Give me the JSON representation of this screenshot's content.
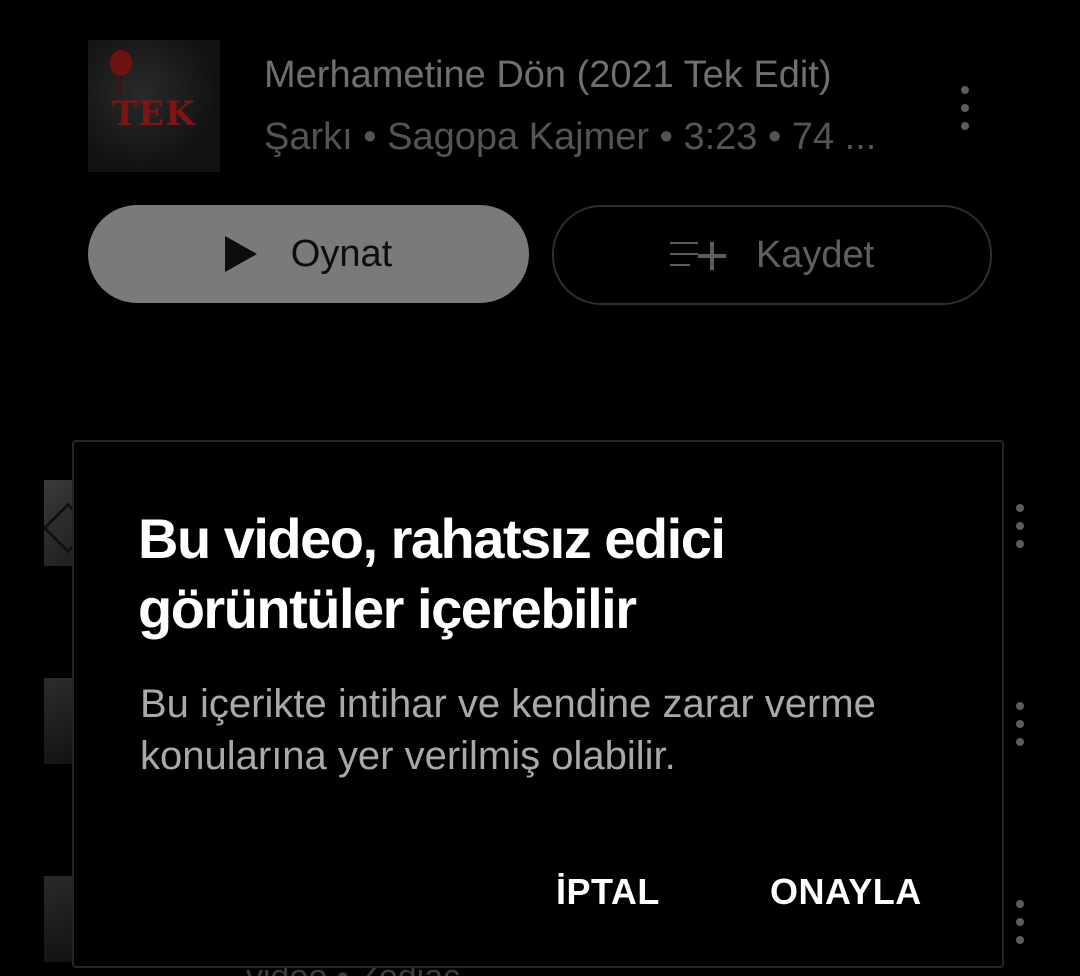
{
  "song": {
    "title": "Merhametine Dön (2021 Tek Edit)",
    "subtitle": "Şarkı • Sagopa Kajmer • 3:23 • 74 ...",
    "thumbnail_text": "TEK"
  },
  "actions": {
    "play_label": "Oynat",
    "save_label": "Kaydet"
  },
  "list": {
    "peek_text": "video • Zodiac"
  },
  "dialog": {
    "title": "Bu video, rahatsız edici görüntüler içerebilir",
    "body": "Bu içerikte intihar ve kendine zarar verme konularına yer verilmiş olabilir.",
    "cancel_label": "İPTAL",
    "confirm_label": "ONAYLA"
  },
  "colors": {
    "background": "#000000",
    "dialog_title": "#ffffff",
    "dialog_body": "#a9a9a9",
    "play_button": "#7a7a7a"
  },
  "icons": [
    "more-vert-icon",
    "play-icon",
    "playlist-add-icon"
  ]
}
